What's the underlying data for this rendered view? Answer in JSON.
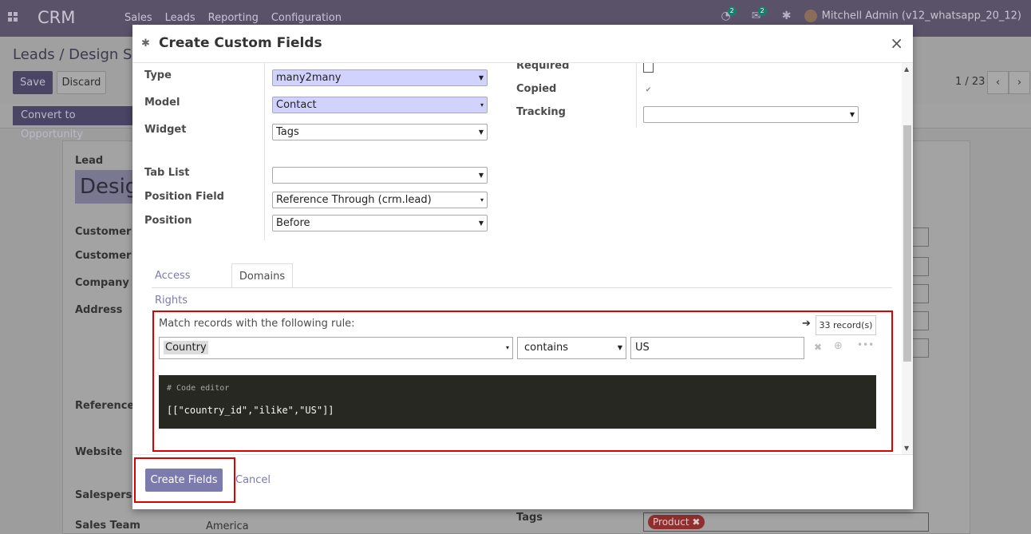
{
  "navbar": {
    "brand": "CRM",
    "menu": [
      "Sales",
      "Leads",
      "Reporting",
      "Configuration"
    ],
    "activity_badge": "2",
    "message_badge": "2",
    "user": "Mitchell Admin (v12_whatsapp_20_12)"
  },
  "control_panel": {
    "breadcrumb": "Leads / Design So",
    "save_label": "Save",
    "discard_label": "Discard",
    "pager": "1 / 23",
    "convert_label": "Convert to Opportunity"
  },
  "form_bg": {
    "lead_label": "Lead",
    "lead_name": "Desig",
    "labels": [
      "Customer",
      "Customer E",
      "Company N",
      "Address",
      "Reference T",
      "Website",
      "Salesperson",
      "Sales Team"
    ],
    "sales_team_value": "America",
    "tags_label": "Tags",
    "tag_value": "Product"
  },
  "modal": {
    "title": "Create Custom Fields",
    "close": "×",
    "fields": {
      "type_label": "Type",
      "type_value": "many2many",
      "model_label": "Model",
      "model_value": "Contact",
      "widget_label": "Widget",
      "widget_value": "Tags",
      "tab_list_label": "Tab List",
      "tab_list_value": "",
      "position_field_label": "Position Field",
      "position_field_value": "Reference Through (crm.lead)",
      "position_label": "Position",
      "position_value": "Before",
      "required_label": "Required",
      "copied_label": "Copied",
      "tracking_label": "Tracking",
      "tracking_value": ""
    },
    "tabs": {
      "access_rights": "Access Rights",
      "domains": "Domains"
    },
    "domain": {
      "match_text": "Match records with the following rule:",
      "record_count": "33 record(s)",
      "field": "Country",
      "operator": "contains",
      "value": "US",
      "code_comment": "# Code editor",
      "code": "[[\"country_id\",\"ilike\",\"US\"]]"
    },
    "footer": {
      "create_label": "Create Fields",
      "cancel_label": "Cancel"
    }
  },
  "colors": {
    "navbar": "#5a5269",
    "primary": "#7c7bad",
    "highlight_select": "#d2d2ff",
    "annotation_red": "#dd0000",
    "code_bg": "#272822"
  }
}
